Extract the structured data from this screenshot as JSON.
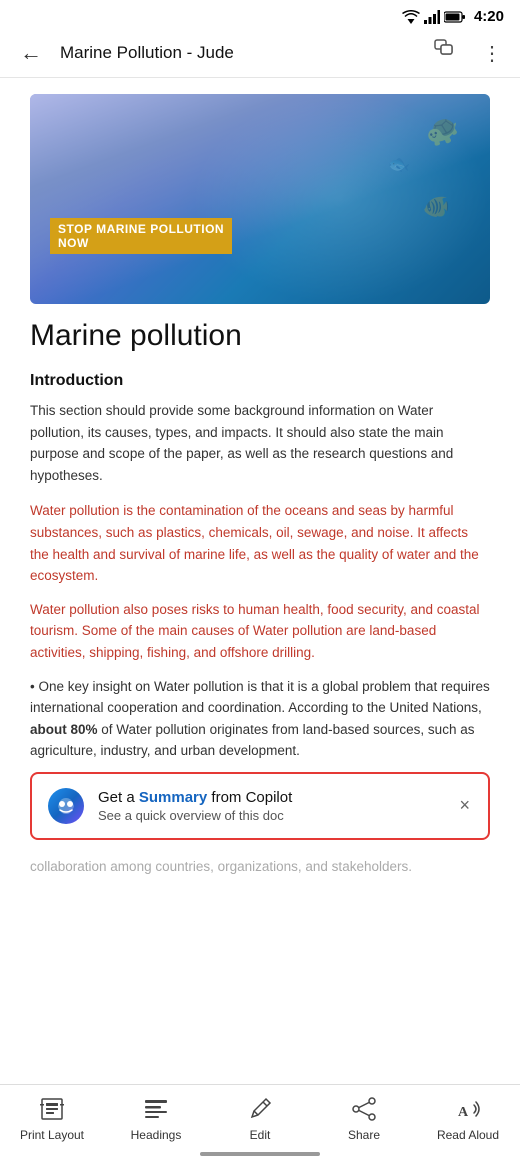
{
  "status_bar": {
    "time": "4:20"
  },
  "top_bar": {
    "title": "Marine Pollution - Judе",
    "back_label": "←"
  },
  "hero": {
    "stop_text_line1": "STOP MARINE POLLUTION",
    "stop_text_line2": "NOW"
  },
  "document": {
    "main_title": "Marine pollution",
    "intro_heading": "Introduction",
    "intro_text": "This section should provide some background information on Water pollution, its causes, types, and impacts. It should also state the main purpose and scope of the paper, as well as the research questions and hypotheses.",
    "red_paragraph1": "Water pollution is the contamination of the oceans and seas by harmful substances, such as plastics, chemicals, oil, sewage, and noise. It affects the health and survival of marine life, as well as the quality of water and the ecosystem.",
    "red_paragraph2": "Water pollution also poses risks to human health, food security, and coastal tourism. Some of the main causes of Water pollution are land-based activities, shipping, fishing, and offshore drilling.",
    "body_paragraph1_start": "• One key insight on Water pollution is that it is a global problem that requires international cooperation and coordination. According to the United Nations, ",
    "body_paragraph1_bold": "about 80%",
    "body_paragraph1_end": " of Water pollution originates from land-based sources, such as agriculture, industry, and urban development.",
    "continuation_text": "collaboration among countries, organizations, and stakeholders."
  },
  "copilot_banner": {
    "main_text_prefix": "Get a ",
    "summary_word": "Summary",
    "main_text_suffix": " from Copilot",
    "sub_text": "See a quick overview of this doc",
    "close_label": "×"
  },
  "bottom_nav": {
    "items": [
      {
        "id": "print-layout",
        "label": "Print\nLayout",
        "icon": "print-layout-icon"
      },
      {
        "id": "headings",
        "label": "Headings",
        "icon": "headings-icon"
      },
      {
        "id": "edit",
        "label": "Edit",
        "icon": "edit-icon"
      },
      {
        "id": "share",
        "label": "Share",
        "icon": "share-icon"
      },
      {
        "id": "read-aloud",
        "label": "Read Aloud",
        "icon": "read-aloud-icon"
      }
    ]
  }
}
